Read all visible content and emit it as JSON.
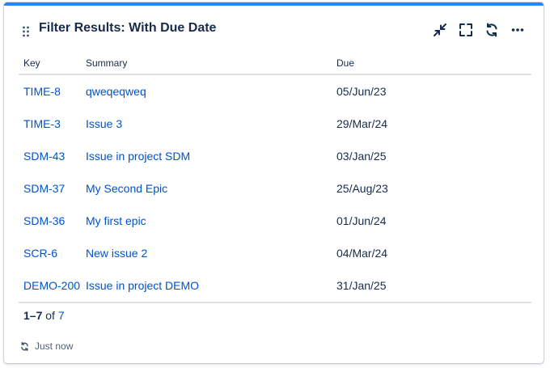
{
  "gadget": {
    "title": "Filter Results: With Due Date",
    "accent_color": "#2684FF",
    "actions": [
      "minimize-icon",
      "fullscreen-icon",
      "refresh-icon",
      "more-icon"
    ]
  },
  "table": {
    "columns": [
      "Key",
      "Summary",
      "Due"
    ],
    "rows": [
      {
        "key": "TIME-8",
        "summary": "qweqeqweq",
        "due": "05/Jun/23"
      },
      {
        "key": "TIME-3",
        "summary": "Issue 3",
        "due": "29/Mar/24"
      },
      {
        "key": "SDM-43",
        "summary": "Issue in project SDM",
        "due": "03/Jan/25"
      },
      {
        "key": "SDM-37",
        "summary": "My Second Epic",
        "due": "25/Aug/23"
      },
      {
        "key": "SDM-36",
        "summary": "My first epic",
        "due": "01/Jun/24"
      },
      {
        "key": "SCR-6",
        "summary": "New issue 2",
        "due": "04/Mar/24"
      },
      {
        "key": "DEMO-200",
        "summary": "Issue in project DEMO",
        "due": "31/Jan/25"
      }
    ]
  },
  "pagination": {
    "range": "1–7",
    "of": "of",
    "total": "7"
  },
  "footer": {
    "refreshed": "Just now"
  },
  "colors": {
    "link": "#0052CC",
    "text": "#172B4D",
    "divider": "#DFE1E6"
  }
}
